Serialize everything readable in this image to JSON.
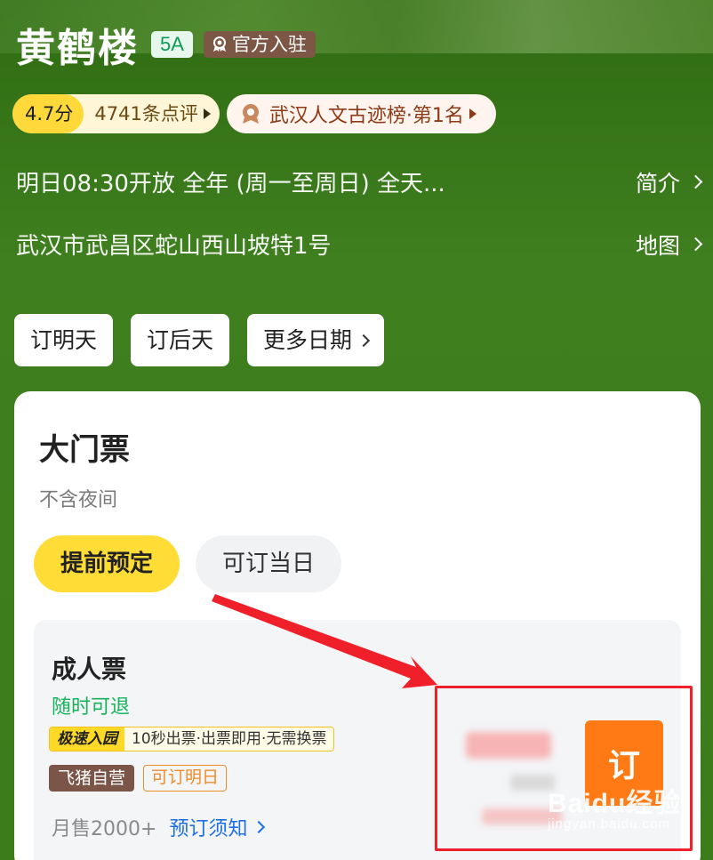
{
  "header": {
    "title": "黄鹤楼",
    "grade_tag": "5A",
    "official_tag": "官方入驻"
  },
  "rating": {
    "score": "4.7分",
    "reviews": "4741条点评"
  },
  "ranking": {
    "label": "武汉人文古迹榜·第1名"
  },
  "hours": {
    "text": "明日08:30开放   全年 (周一至周日) 全天...",
    "link": "简介"
  },
  "address": {
    "text": "武汉市武昌区蛇山西山坡特1号",
    "link": "地图"
  },
  "date_buttons": [
    "订明天",
    "订后天",
    "更多日期"
  ],
  "card": {
    "title": "大门票",
    "subtitle": "不含夜间",
    "segments": [
      "提前预定",
      "可订当日"
    ]
  },
  "ticket": {
    "name": "成人票",
    "refund": "随时可退",
    "express_label": "极速入园",
    "express_value": "10秒出票·出票即用·无需换票",
    "tag_self": "飞猪自营",
    "tag_tomorrow": "可订明日",
    "sales": "月售2000+",
    "notice": "预订须知",
    "book_label": "订"
  },
  "watermark": {
    "main": "Baidu经验",
    "sub": "jingyan.baidu.com"
  },
  "colors": {
    "background_green": "#3d7a1c",
    "accent_yellow": "#ffdc36",
    "book_orange": "#ff7a14",
    "highlight_red": "#f0202a",
    "refund_green": "#16b35c",
    "link_blue": "#1e6fe6"
  }
}
